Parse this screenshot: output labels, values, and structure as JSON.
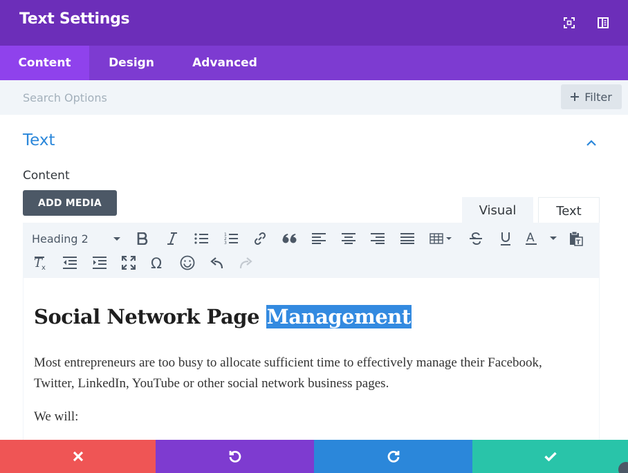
{
  "header": {
    "title": "Text Settings",
    "icons": [
      "fullscreen-icon",
      "sidebar-layout-icon"
    ]
  },
  "tabs": [
    {
      "label": "Content",
      "active": true
    },
    {
      "label": "Design",
      "active": false
    },
    {
      "label": "Advanced",
      "active": false
    }
  ],
  "search": {
    "placeholder": "Search Options",
    "value": ""
  },
  "filter": {
    "label": "Filter",
    "icon": "plus-icon"
  },
  "section": {
    "title": "Text",
    "expanded": true
  },
  "field": {
    "label": "Content"
  },
  "add_media": {
    "label": "ADD MEDIA"
  },
  "editor_modes": {
    "visual": "Visual",
    "text": "Text",
    "active": "Visual"
  },
  "toolbar": {
    "format_value": "Heading 2",
    "row1": [
      "bold-icon",
      "italic-icon",
      "bullet-list-icon",
      "numbered-list-icon",
      "link-icon",
      "blockquote-icon",
      "align-left-icon",
      "align-center-icon",
      "align-right-icon",
      "align-justify-icon",
      "table-icon",
      "strikethrough-icon",
      "underline-icon",
      "text-color-icon",
      "paste-text-icon"
    ],
    "row2": [
      "clear-formatting-icon",
      "outdent-icon",
      "indent-icon",
      "fullscreen-icon",
      "special-character-icon",
      "emoji-icon",
      "undo-icon",
      "redo-icon"
    ]
  },
  "editor": {
    "heading_plain": "Social Network Page",
    "heading_selected": "Management",
    "paragraph1": "Most entrepreneurs are too busy to allocate sufficient time to effectively manage their Facebook, Twitter, LinkedIn, YouTube or other social network business pages.",
    "paragraph2": "We will:"
  },
  "footer": {
    "buttons": [
      "close-icon",
      "undo-icon",
      "redo-icon",
      "check-icon"
    ]
  },
  "colors": {
    "header_bg": "#6c2eb9",
    "tabs_bg": "#7d3bd1",
    "active_tab_bg": "#8f42ec",
    "accent_blue": "#2b87da",
    "cancel_red": "#ef5555",
    "undo_purple": "#7e3bd0",
    "save_green": "#29c4a9"
  }
}
